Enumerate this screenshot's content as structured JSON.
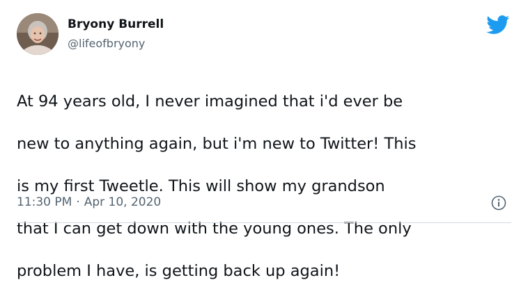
{
  "user": {
    "name": "Bryony Burrell",
    "handle": "@lifeofbryony"
  },
  "tweet": {
    "text_lines": [
      "At 94 years old, I never imagined that i'd ever be",
      "new to anything again, but i'm new to Twitter! This",
      "is my first Tweetle. This will show my grandson",
      "that I can get down with the young ones. The only",
      "problem I have, is getting back up again!"
    ],
    "time": "11:30 PM",
    "separator": "·",
    "date": "Apr 10, 2020"
  },
  "icons": {
    "brand": "twitter-bird-icon",
    "info": "info-icon"
  },
  "colors": {
    "brand": "#1d9bf0",
    "secondary_text": "#536471",
    "primary_text": "#0f1419"
  }
}
